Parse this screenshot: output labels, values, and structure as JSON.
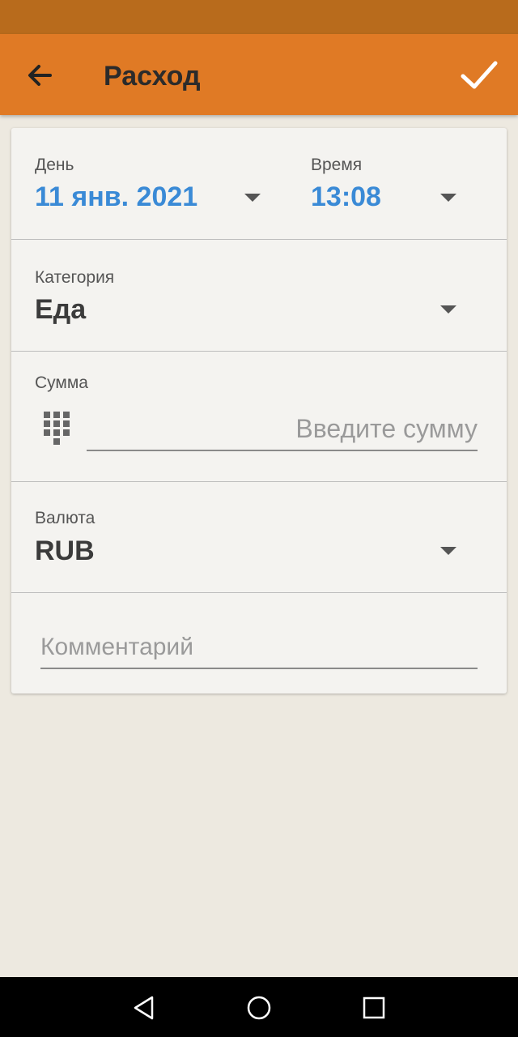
{
  "app_bar": {
    "title": "Расход",
    "back_icon": "arrow-left-icon",
    "confirm_icon": "check-icon"
  },
  "form": {
    "day": {
      "label": "День",
      "value": "11 янв. 2021"
    },
    "time": {
      "label": "Время",
      "value": "13:08"
    },
    "category": {
      "label": "Категория",
      "value": "Еда"
    },
    "amount": {
      "label": "Сумма",
      "placeholder": "Введите сумму",
      "value": ""
    },
    "currency": {
      "label": "Валюта",
      "value": "RUB"
    },
    "comment": {
      "placeholder": "Комментарий",
      "value": ""
    }
  },
  "nav_bar": {
    "back_icon": "triangle-back-icon",
    "home_icon": "circle-home-icon",
    "recents_icon": "square-recents-icon"
  },
  "colors": {
    "status_bar": "#b86b1c",
    "app_bar": "#e07a25",
    "accent_blue": "#3a8ad6",
    "background": "#ede9e0",
    "card": "#f4f3f0"
  }
}
